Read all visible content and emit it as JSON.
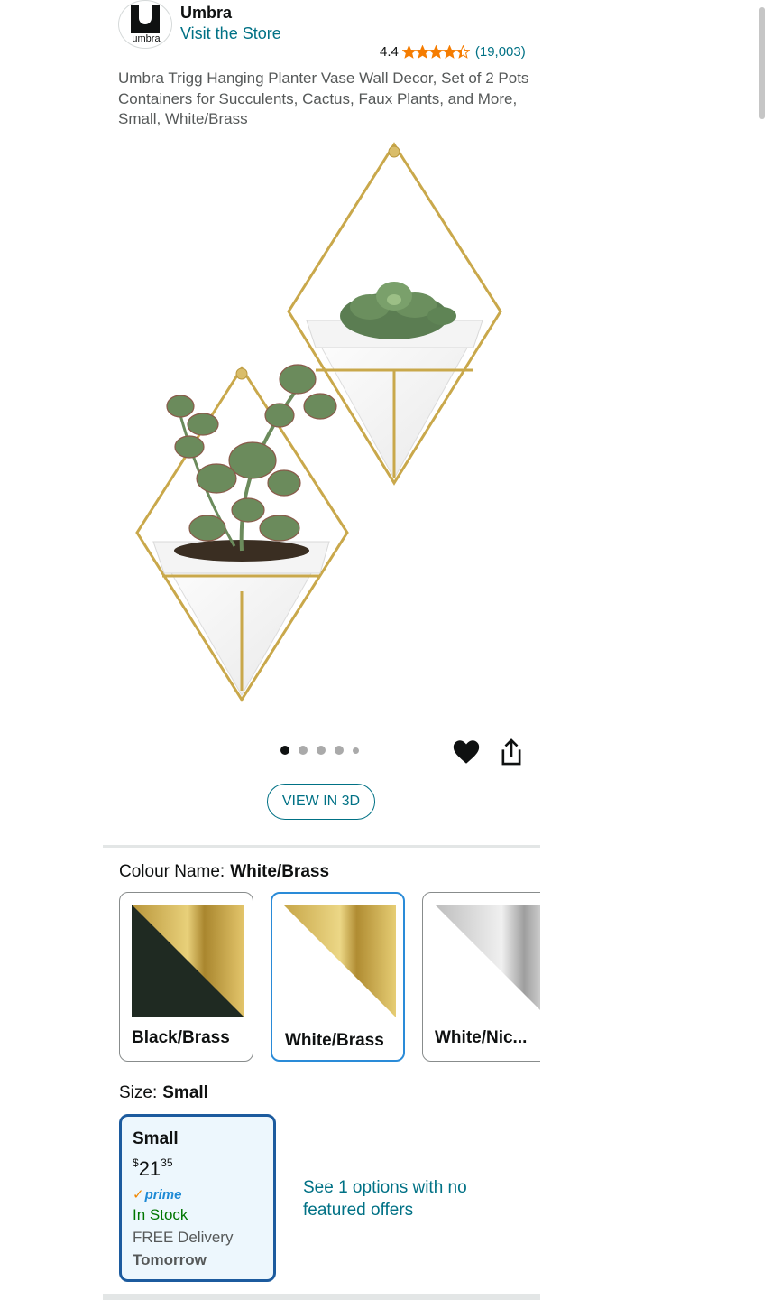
{
  "brand": {
    "logo_text": "umbra",
    "name": "Umbra",
    "store_link": "Visit the Store"
  },
  "rating": {
    "value": "4.4",
    "stars": 4.4,
    "count": "(19,003)",
    "star_color": "#f57c00"
  },
  "product": {
    "title": "Umbra Trigg Hanging Planter Vase Wall Decor, Set of 2 Pots Containers for Succulents, Cactus, Faux Plants, and More, Small, White/Brass"
  },
  "gallery": {
    "image_count": 5,
    "active_index": 0,
    "wishlist_icon": "heart-icon",
    "share_icon": "share-icon",
    "view_3d_label": "VIEW IN 3D"
  },
  "colour": {
    "label": "Colour Name:",
    "selected": "White/Brass",
    "options": [
      {
        "label": "Black/Brass"
      },
      {
        "label": "White/Brass"
      },
      {
        "label": "White/Nic..."
      }
    ]
  },
  "size": {
    "label": "Size:",
    "selected": "Small",
    "card": {
      "name": "Small",
      "currency": "$",
      "price_whole": "21",
      "price_fraction": "35",
      "prime_label": "prime",
      "stock": "In Stock",
      "delivery": "FREE Delivery",
      "delivery_when": "Tomorrow"
    },
    "other_options": "See 1 options with no featured offers"
  },
  "colors": {
    "link": "#007185",
    "brass": "#c9a84b",
    "prime_blue": "#1e8ad5",
    "in_stock": "#007600",
    "selected_border": "#2a8bd8"
  }
}
